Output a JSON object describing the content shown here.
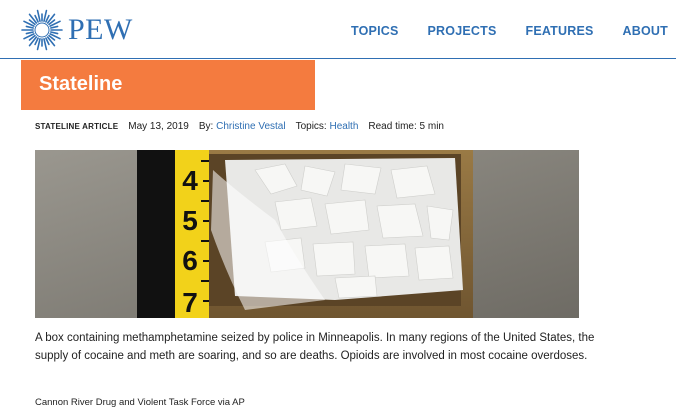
{
  "brand": {
    "name": "PEW",
    "color": "#2f6fb3"
  },
  "nav": {
    "items": [
      "TOPICS",
      "PROJECTS",
      "FEATURES",
      "ABOUT"
    ]
  },
  "banner": {
    "title": "Stateline",
    "color": "#f47b3f"
  },
  "meta": {
    "kind": "STATELINE ARTICLE",
    "date": "May 13, 2019",
    "by_label": "By:",
    "author": "Christine Vestal",
    "topics_label": "Topics:",
    "topic": "Health",
    "read_time": "Read time: 5 min"
  },
  "photo": {
    "ruler_numbers": [
      "4",
      "5",
      "6",
      "7"
    ]
  },
  "caption": "A box containing methamphetamine seized by police in Minneapolis. In many regions of the United States, the supply of cocaine and meth are soaring, and so are deaths. Opioids are involved in most cocaine overdoses.",
  "credit": "Cannon River Drug and Violent Task Force via AP"
}
